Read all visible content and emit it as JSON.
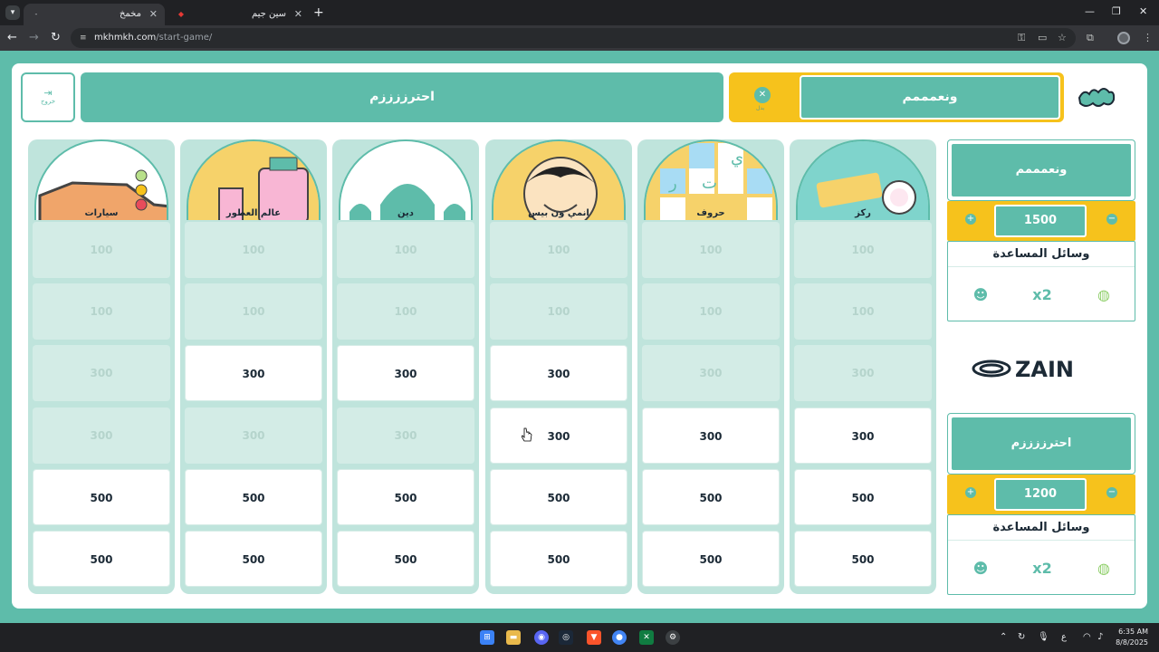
{
  "browser": {
    "tabs": [
      {
        "title": "مخمخ",
        "active": true
      },
      {
        "title": "سين جيم",
        "active": false
      }
    ],
    "url_domain": "mkhmkh.com",
    "url_path": "/start-game/"
  },
  "header": {
    "exit_label": "خروج",
    "left_team_banner": "احترززززم",
    "current_turn_team": "ونعمممم",
    "switch_label": "بدل"
  },
  "categories": [
    {
      "name": "سيارات",
      "theme": "cars"
    },
    {
      "name": "عالم العطور",
      "theme": "perfume"
    },
    {
      "name": "دين",
      "theme": "mosque"
    },
    {
      "name": "انمي ون بيس",
      "theme": "anime"
    },
    {
      "name": "حروف",
      "theme": "letters"
    },
    {
      "name": "ركز",
      "theme": "play"
    }
  ],
  "board": {
    "rows": [
      [
        "100",
        "100",
        "100",
        "100",
        "100",
        "100"
      ],
      [
        "100",
        "100",
        "100",
        "100",
        "100",
        "100"
      ],
      [
        "300",
        "300",
        "300",
        "300",
        "300",
        "300"
      ],
      [
        "300",
        "300",
        "300",
        "300",
        "300",
        "300"
      ],
      [
        "500",
        "500",
        "500",
        "500",
        "500",
        "500"
      ],
      [
        "500",
        "500",
        "500",
        "500",
        "500",
        "500"
      ]
    ],
    "used": [
      [
        true,
        true,
        true,
        true,
        true,
        true
      ],
      [
        true,
        true,
        true,
        true,
        true,
        true
      ],
      [
        true,
        false,
        false,
        false,
        true,
        true
      ],
      [
        true,
        true,
        true,
        false,
        false,
        false
      ],
      [
        false,
        false,
        false,
        false,
        false,
        false
      ],
      [
        false,
        false,
        false,
        false,
        false,
        false
      ]
    ]
  },
  "teams": [
    {
      "name": "ونعمممم",
      "score": "1500",
      "aids_title": "وسائل المساعدة",
      "aids": [
        "timer-icon",
        "double-icon",
        "call-friend-icon"
      ]
    },
    {
      "name": "احترززززم",
      "score": "1200",
      "aids_title": "وسائل المساعدة",
      "aids": [
        "timer-icon",
        "double-icon",
        "call-friend-icon"
      ]
    }
  ],
  "sponsor": "ZAIN",
  "taskbar": {
    "time": "6:35 AM",
    "date": "8/8/2025",
    "lang": "ع"
  },
  "colors": {
    "teal": "#5ebcaa",
    "yellow": "#f6c21c",
    "used_cell": "#d3ece6"
  }
}
